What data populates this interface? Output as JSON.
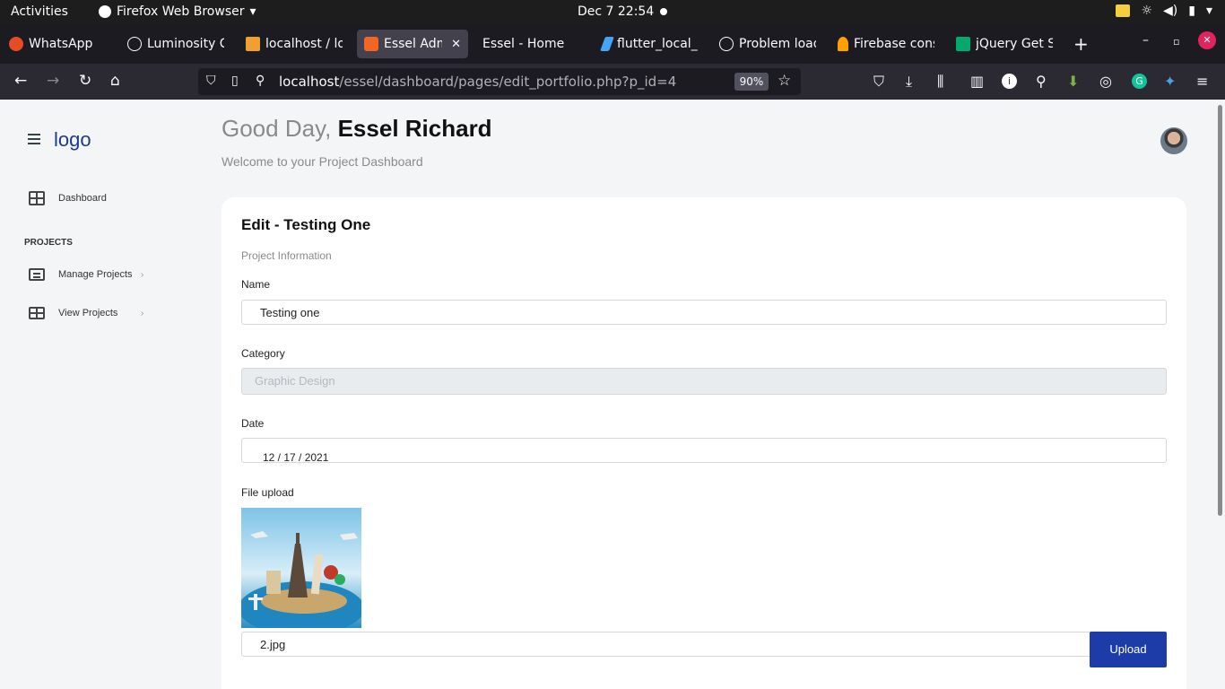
{
  "system": {
    "activities": "Activities",
    "app_name": "Firefox Web Browser",
    "clock": "Dec 7  22:54"
  },
  "tabs": [
    {
      "label": "WhatsApp",
      "color": "#e44d26",
      "active": false
    },
    {
      "label": "Luminosity C",
      "color": "#ffffff",
      "active": false
    },
    {
      "label": "localhost / lo",
      "color": "#f0a030",
      "active": false
    },
    {
      "label": "Essel Admi",
      "color": "#f26522",
      "active": true
    },
    {
      "label": "Essel - Home",
      "color": "",
      "active": false
    },
    {
      "label": "flutter_local_",
      "color": "#42a5f5",
      "active": false
    },
    {
      "label": "Problem load",
      "color": "#ffffff",
      "active": false
    },
    {
      "label": "Firebase cons",
      "color": "#ffa000",
      "active": false
    },
    {
      "label": "jQuery Get St",
      "color": "#04aa6d",
      "active": false
    }
  ],
  "address": {
    "host": "localhost",
    "path": "/essel/dashboard/pages/edit_portfolio.php?p_id=4",
    "zoom": "90%"
  },
  "sidebar": {
    "logo": "logo",
    "items": [
      {
        "label": "Dashboard"
      },
      {
        "label": "Manage Projects"
      },
      {
        "label": "View Projects"
      }
    ],
    "section_heading": "PROJECTS"
  },
  "header": {
    "greeting": "Good Day,",
    "user_name": "Essel Richard",
    "welcome": "Welcome to your Project Dashboard"
  },
  "form": {
    "title": "Edit - Testing One",
    "section": "Project Information",
    "name_label": "Name",
    "name_value": "Testing one",
    "category_label": "Category",
    "category_value": "Graphic Design",
    "date_label": "Date",
    "date_value": "12 / 17 / 2021",
    "file_label": "File upload",
    "file_value": "2.jpg",
    "upload_button": "Upload"
  },
  "colors": {
    "primary": "#1e3ca8",
    "logo": "#1e3a8a"
  }
}
